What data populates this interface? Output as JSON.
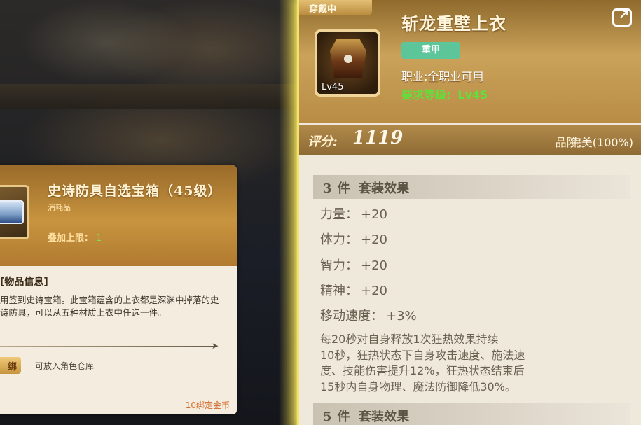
{
  "left_card": {
    "title": "史诗防具自选宝箱（45级）",
    "subtitle": "消耗品",
    "limit_label": "叠加上限：",
    "limit_value": "1",
    "section_title": "[物品信息]",
    "description": "用签到史诗宝箱。此宝箱蕴含的上衣都是深渊中掉落的史诗防具，可以从五种材质上衣中任选一件。",
    "badge": "绑",
    "storage_note": "可放入角色仓库",
    "price": "10绑定金币",
    "icon": "treasure-chest-icon"
  },
  "right_panel": {
    "equip_tag": "穿戴中",
    "title": "斩龙重壁上衣",
    "type_badge": "重甲",
    "class_text": "职业:全职业可用",
    "req_label": "要求等级:",
    "req_value": "Lv45",
    "icon_level": "Lv45",
    "icon": "heavy-armor-icon",
    "share_icon": "share-icon",
    "score_label": "评分:",
    "score_value": "1119",
    "grade_label": "品阶:",
    "grade_value": "完美(100%)",
    "set_effects": [
      {
        "count": "3",
        "unit": "件",
        "label": "套装效果",
        "stats": [
          {
            "name": "力量：",
            "value": "+20"
          },
          {
            "name": "体力：",
            "value": "+20"
          },
          {
            "name": "智力：",
            "value": "+20"
          },
          {
            "name": "精神：",
            "value": "+20"
          },
          {
            "name": "移动速度：",
            "value": "+3%"
          }
        ],
        "effect_lines": [
          "每20秒对自身释放1次狂热效果持续",
          "10秒，狂热状态下自身攻击速度、施法速",
          "度、技能伤害提升12%，狂热状态结束后",
          "15秒内自身物理、魔法防御降低30%。"
        ]
      },
      {
        "count": "5",
        "unit": "件",
        "label": "套装效果"
      }
    ]
  },
  "colors": {
    "accent_gold": "#caa25a",
    "requirement_green": "#5ee13a",
    "type_badge_green": "#5cc59a",
    "price_orange": "#d26a2c"
  }
}
